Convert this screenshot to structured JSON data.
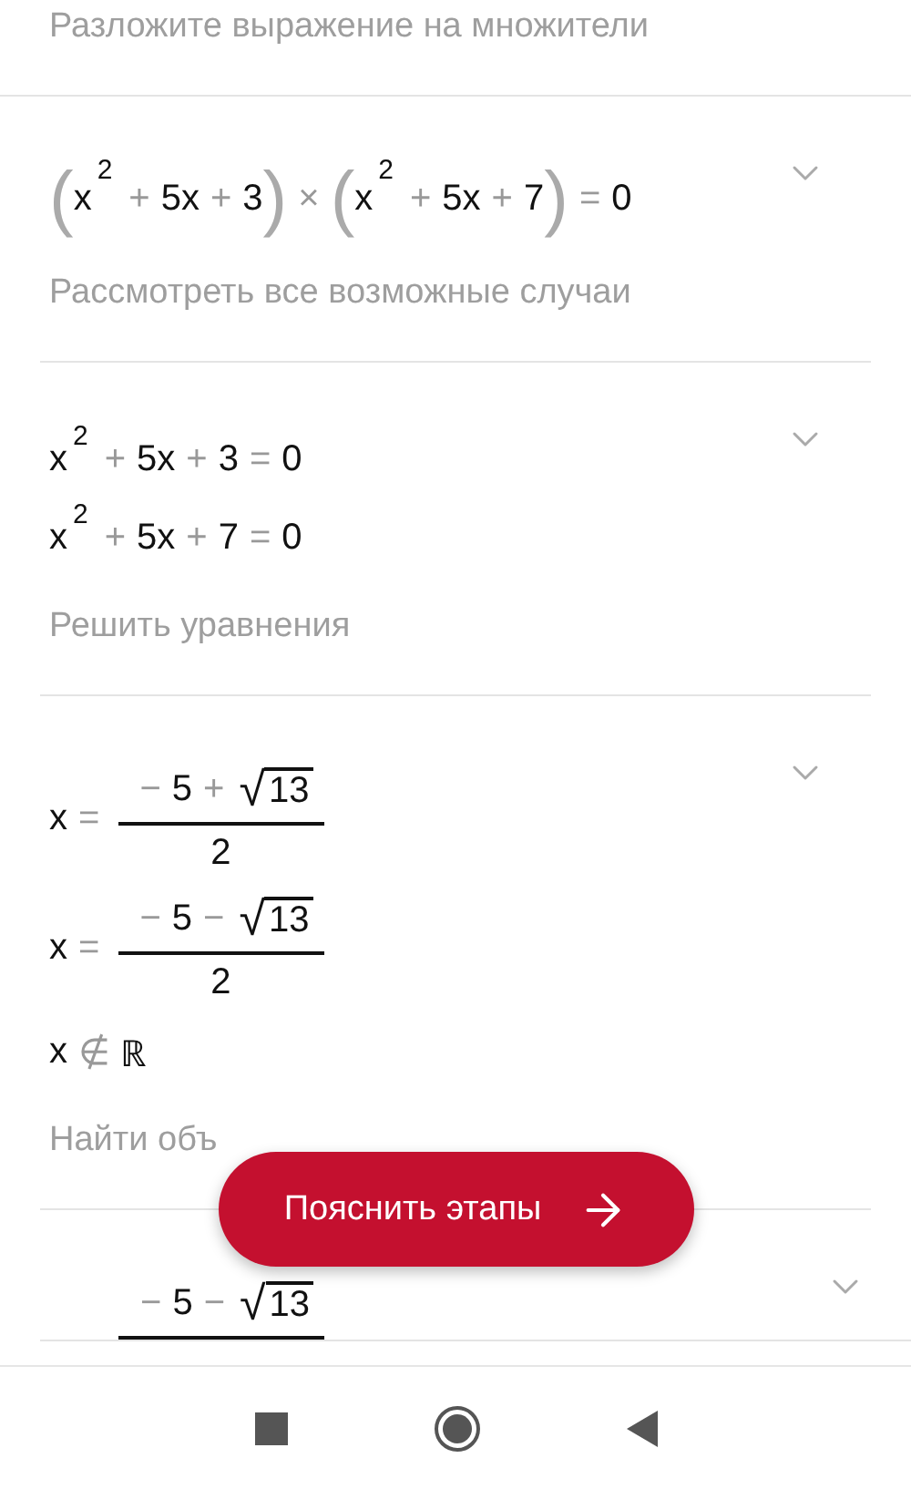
{
  "header": {
    "caption": "Разложите выражение на множители"
  },
  "steps": [
    {
      "lines": [
        [
          {
            "kind": "paren",
            "text": "("
          },
          {
            "kind": "var",
            "text": "x"
          },
          {
            "kind": "sup",
            "text": "2"
          },
          {
            "kind": "op",
            "text": "+"
          },
          {
            "kind": "num",
            "text": "5x"
          },
          {
            "kind": "op",
            "text": "+"
          },
          {
            "kind": "num",
            "text": "3"
          },
          {
            "kind": "paren",
            "text": ")"
          },
          {
            "kind": "op",
            "text": "×"
          },
          {
            "kind": "paren",
            "text": "("
          },
          {
            "kind": "var",
            "text": "x"
          },
          {
            "kind": "sup",
            "text": "2"
          },
          {
            "kind": "op",
            "text": "+"
          },
          {
            "kind": "num",
            "text": "5x"
          },
          {
            "kind": "op",
            "text": "+"
          },
          {
            "kind": "num",
            "text": "7"
          },
          {
            "kind": "paren",
            "text": ")"
          },
          {
            "kind": "op",
            "text": "="
          },
          {
            "kind": "num",
            "text": "0"
          }
        ]
      ],
      "caption": "Рассмотреть все возможные случаи"
    },
    {
      "lines": [
        [
          {
            "kind": "var",
            "text": "x"
          },
          {
            "kind": "sup",
            "text": "2"
          },
          {
            "kind": "op",
            "text": "+"
          },
          {
            "kind": "num",
            "text": "5x"
          },
          {
            "kind": "op",
            "text": "+"
          },
          {
            "kind": "num",
            "text": "3"
          },
          {
            "kind": "op",
            "text": "="
          },
          {
            "kind": "num",
            "text": "0"
          }
        ],
        [
          {
            "kind": "var",
            "text": "x"
          },
          {
            "kind": "sup",
            "text": "2"
          },
          {
            "kind": "op",
            "text": "+"
          },
          {
            "kind": "num",
            "text": "5x"
          },
          {
            "kind": "op",
            "text": "+"
          },
          {
            "kind": "num",
            "text": "7"
          },
          {
            "kind": "op",
            "text": "="
          },
          {
            "kind": "num",
            "text": "0"
          }
        ]
      ],
      "caption": "Решить уравнения"
    },
    {
      "lines": [
        [
          {
            "kind": "var",
            "text": "x"
          },
          {
            "kind": "op",
            "text": "="
          },
          {
            "kind": "fraction",
            "num": [
              {
                "kind": "op",
                "text": "−"
              },
              {
                "kind": "num",
                "text": "5"
              },
              {
                "kind": "op",
                "text": "+"
              },
              {
                "kind": "sqrt",
                "symbol": "√",
                "text": "13"
              }
            ],
            "den": [
              {
                "kind": "num",
                "text": "2"
              }
            ]
          }
        ],
        [
          {
            "kind": "var",
            "text": "x"
          },
          {
            "kind": "op",
            "text": "="
          },
          {
            "kind": "fraction",
            "num": [
              {
                "kind": "op",
                "text": "−"
              },
              {
                "kind": "num",
                "text": "5"
              },
              {
                "kind": "op",
                "text": "−"
              },
              {
                "kind": "sqrt",
                "symbol": "√",
                "text": "13"
              }
            ],
            "den": [
              {
                "kind": "num",
                "text": "2"
              }
            ]
          }
        ],
        [
          {
            "kind": "var",
            "text": "x"
          },
          {
            "kind": "op",
            "text": "∉"
          },
          {
            "kind": "num",
            "text": "ℝ"
          }
        ]
      ],
      "caption": "Найти объ"
    },
    {
      "lines": [
        [
          {
            "kind": "fraction",
            "num": [
              {
                "kind": "op",
                "text": "−"
              },
              {
                "kind": "num",
                "text": "5"
              },
              {
                "kind": "op",
                "text": "−"
              },
              {
                "kind": "sqrt",
                "symbol": "√",
                "text": "13"
              }
            ]
          }
        ]
      ]
    }
  ],
  "explain_button": {
    "label": "Пояснить этапы"
  }
}
